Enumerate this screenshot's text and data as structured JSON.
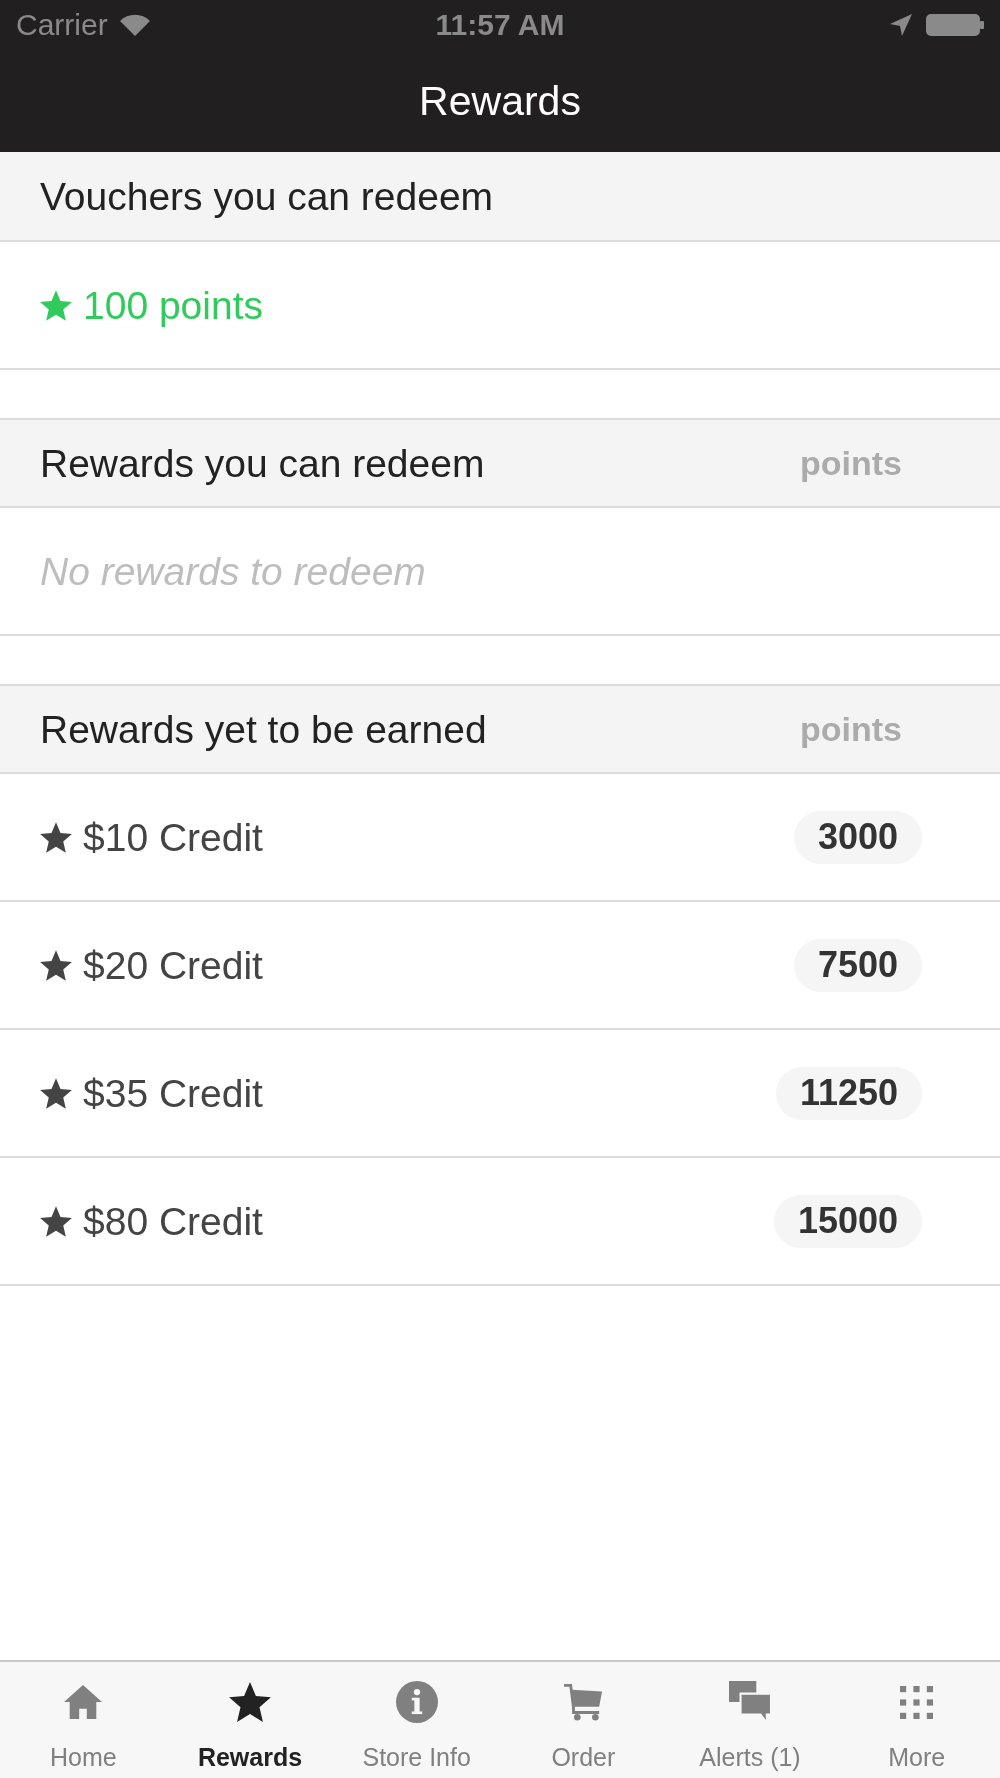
{
  "status_bar": {
    "carrier": "Carrier",
    "time": "11:57 AM"
  },
  "nav_bar": {
    "title": "Rewards"
  },
  "sections": [
    {
      "title": "Vouchers you can redeem",
      "items": [
        {
          "kind": "voucher",
          "label": "100 points"
        }
      ]
    },
    {
      "title": "Rewards you can redeem",
      "column_label": "points",
      "items": [
        {
          "kind": "empty",
          "label": "No rewards to redeem"
        }
      ]
    },
    {
      "title": "Rewards yet to be earned",
      "column_label": "points",
      "items": [
        {
          "kind": "reward",
          "label": "$10 Credit",
          "points": "3000"
        },
        {
          "kind": "reward",
          "label": "$20 Credit",
          "points": "7500"
        },
        {
          "kind": "reward",
          "label": "$35 Credit",
          "points": "11250"
        },
        {
          "kind": "reward",
          "label": "$80 Credit",
          "points": "15000"
        }
      ]
    }
  ],
  "tab_bar": [
    {
      "label": "Home",
      "selected": false
    },
    {
      "label": "Rewards",
      "selected": true
    },
    {
      "label": "Store Info",
      "selected": false
    },
    {
      "label": "Order",
      "selected": false
    },
    {
      "label": "Alerts (1)",
      "selected": false
    },
    {
      "label": "More",
      "selected": false
    }
  ]
}
